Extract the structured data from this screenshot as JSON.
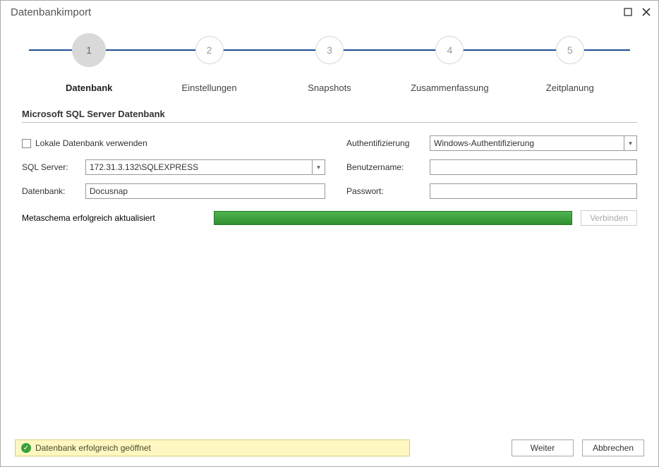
{
  "window": {
    "title": "Datenbankimport"
  },
  "steps": [
    {
      "num": "1",
      "label": "Datenbank",
      "active": true
    },
    {
      "num": "2",
      "label": "Einstellungen",
      "active": false
    },
    {
      "num": "3",
      "label": "Snapshots",
      "active": false
    },
    {
      "num": "4",
      "label": "Zusammenfassung",
      "active": false
    },
    {
      "num": "5",
      "label": "Zeitplanung",
      "active": false
    }
  ],
  "section": {
    "title": "Microsoft SQL Server Datenbank"
  },
  "form": {
    "use_local_label": "Lokale Datenbank verwenden",
    "sqlserver_label": "SQL Server:",
    "sqlserver_value": "172.31.3.132\\SQLEXPRESS",
    "database_label": "Datenbank:",
    "database_value": "Docusnap",
    "auth_label": "Authentifizierung",
    "auth_value": "Windows-Authentifizierung",
    "user_label": "Benutzername:",
    "user_value": "",
    "pass_label": "Passwort:",
    "pass_value": "",
    "metaschema_msg": "Metaschema erfolgreich aktualisiert",
    "connect_label": "Verbinden"
  },
  "status": {
    "message": "Datenbank erfolgreich geöffnet"
  },
  "buttons": {
    "next": "Weiter",
    "cancel": "Abbrechen"
  }
}
